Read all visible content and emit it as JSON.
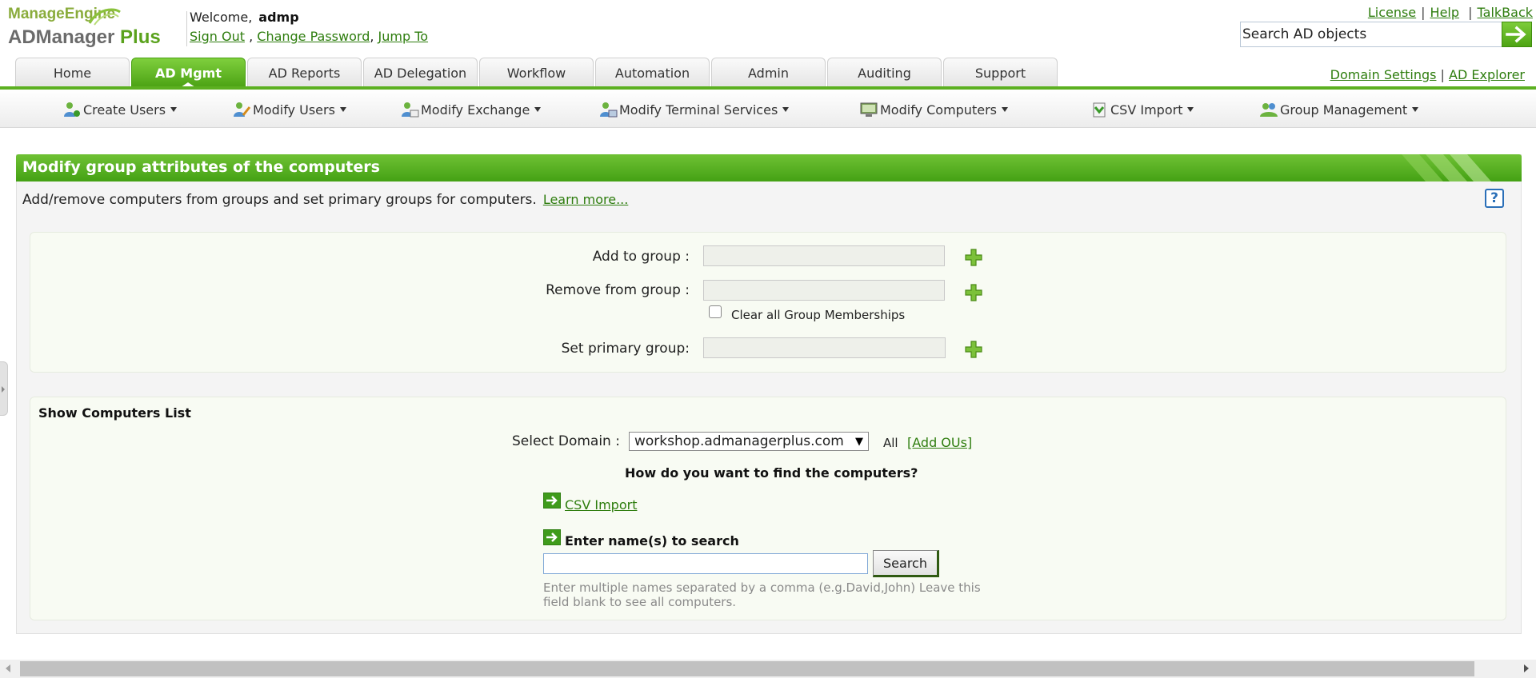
{
  "brand": {
    "top": "ManageEngine",
    "product": "ADManager",
    "product_suffix": "Plus"
  },
  "header": {
    "welcome_label": "Welcome,",
    "username": "admp",
    "sign_out": "Sign Out",
    "change_password": "Change Password",
    "jump_to": "Jump To",
    "license": "License",
    "help": "Help",
    "talkback": "TalkBack",
    "search_value": "Search AD objects"
  },
  "tabs": [
    {
      "label": "Home"
    },
    {
      "label": "AD Mgmt",
      "active": true
    },
    {
      "label": "AD Reports"
    },
    {
      "label": "AD Delegation"
    },
    {
      "label": "Workflow"
    },
    {
      "label": "Automation"
    },
    {
      "label": "Admin"
    },
    {
      "label": "Auditing"
    },
    {
      "label": "Support"
    }
  ],
  "tab_links": {
    "domain_settings": "Domain Settings",
    "ad_explorer": "AD Explorer"
  },
  "submenu": [
    {
      "label": "Create Users",
      "icon": "create-users-icon"
    },
    {
      "label": "Modify Users",
      "icon": "modify-users-icon"
    },
    {
      "label": "Modify Exchange",
      "icon": "modify-exchange-icon"
    },
    {
      "label": "Modify Terminal Services",
      "icon": "terminal-services-icon"
    },
    {
      "label": "Modify Computers",
      "icon": "computer-icon"
    },
    {
      "label": "CSV Import",
      "icon": "csv-import-icon"
    },
    {
      "label": "Group Management",
      "icon": "group-management-icon"
    }
  ],
  "panel": {
    "title": "Modify group attributes of the computers",
    "description": "Add/remove computers from groups and set primary groups for computers.",
    "learn_more": "Learn more...",
    "help": "?"
  },
  "groups": {
    "add_label": "Add to group :",
    "remove_label": "Remove from group :",
    "clear_label": "Clear all Group Memberships",
    "primary_label": "Set primary group:"
  },
  "computers": {
    "title": "Show Computers List",
    "domain_label": "Select Domain :",
    "domain_value": "workshop.admanagerplus.com",
    "all": "All",
    "add_ous": "[Add OUs]",
    "question": "How do you want to find the computers?",
    "csv_import": "CSV Import",
    "enter_names": "Enter name(s) to search",
    "search_button": "Search",
    "hint": "Enter multiple names separated by a comma (e.g.David,John) Leave this field blank to see all computers."
  },
  "colors": {
    "accent_green": "#4aa113",
    "link_green": "#2e7d0e",
    "help_blue": "#2a6fb8"
  }
}
